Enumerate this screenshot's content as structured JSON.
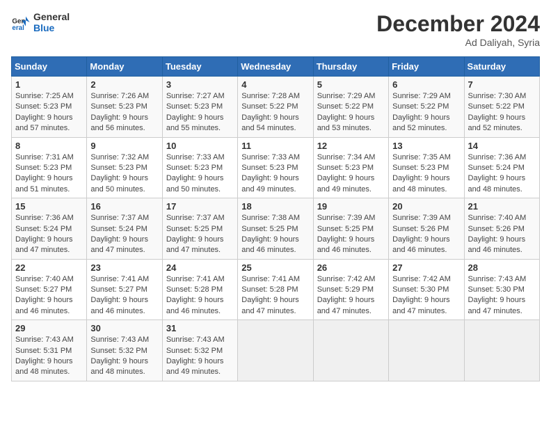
{
  "header": {
    "logo_line1": "General",
    "logo_line2": "Blue",
    "month_title": "December 2024",
    "location": "Ad Daliyah, Syria"
  },
  "days_of_week": [
    "Sunday",
    "Monday",
    "Tuesday",
    "Wednesday",
    "Thursday",
    "Friday",
    "Saturday"
  ],
  "weeks": [
    [
      {
        "day": "1",
        "sunrise": "7:25 AM",
        "sunset": "5:23 PM",
        "daylight_h": "9",
        "daylight_m": "57"
      },
      {
        "day": "2",
        "sunrise": "7:26 AM",
        "sunset": "5:23 PM",
        "daylight_h": "9",
        "daylight_m": "56"
      },
      {
        "day": "3",
        "sunrise": "7:27 AM",
        "sunset": "5:23 PM",
        "daylight_h": "9",
        "daylight_m": "55"
      },
      {
        "day": "4",
        "sunrise": "7:28 AM",
        "sunset": "5:22 PM",
        "daylight_h": "9",
        "daylight_m": "54"
      },
      {
        "day": "5",
        "sunrise": "7:29 AM",
        "sunset": "5:22 PM",
        "daylight_h": "9",
        "daylight_m": "53"
      },
      {
        "day": "6",
        "sunrise": "7:29 AM",
        "sunset": "5:22 PM",
        "daylight_h": "9",
        "daylight_m": "52"
      },
      {
        "day": "7",
        "sunrise": "7:30 AM",
        "sunset": "5:22 PM",
        "daylight_h": "9",
        "daylight_m": "52"
      }
    ],
    [
      {
        "day": "8",
        "sunrise": "7:31 AM",
        "sunset": "5:23 PM",
        "daylight_h": "9",
        "daylight_m": "51"
      },
      {
        "day": "9",
        "sunrise": "7:32 AM",
        "sunset": "5:23 PM",
        "daylight_h": "9",
        "daylight_m": "50"
      },
      {
        "day": "10",
        "sunrise": "7:33 AM",
        "sunset": "5:23 PM",
        "daylight_h": "9",
        "daylight_m": "50"
      },
      {
        "day": "11",
        "sunrise": "7:33 AM",
        "sunset": "5:23 PM",
        "daylight_h": "9",
        "daylight_m": "49"
      },
      {
        "day": "12",
        "sunrise": "7:34 AM",
        "sunset": "5:23 PM",
        "daylight_h": "9",
        "daylight_m": "49"
      },
      {
        "day": "13",
        "sunrise": "7:35 AM",
        "sunset": "5:23 PM",
        "daylight_h": "9",
        "daylight_m": "48"
      },
      {
        "day": "14",
        "sunrise": "7:36 AM",
        "sunset": "5:24 PM",
        "daylight_h": "9",
        "daylight_m": "48"
      }
    ],
    [
      {
        "day": "15",
        "sunrise": "7:36 AM",
        "sunset": "5:24 PM",
        "daylight_h": "9",
        "daylight_m": "47"
      },
      {
        "day": "16",
        "sunrise": "7:37 AM",
        "sunset": "5:24 PM",
        "daylight_h": "9",
        "daylight_m": "47"
      },
      {
        "day": "17",
        "sunrise": "7:37 AM",
        "sunset": "5:25 PM",
        "daylight_h": "9",
        "daylight_m": "47"
      },
      {
        "day": "18",
        "sunrise": "7:38 AM",
        "sunset": "5:25 PM",
        "daylight_h": "9",
        "daylight_m": "46"
      },
      {
        "day": "19",
        "sunrise": "7:39 AM",
        "sunset": "5:25 PM",
        "daylight_h": "9",
        "daylight_m": "46"
      },
      {
        "day": "20",
        "sunrise": "7:39 AM",
        "sunset": "5:26 PM",
        "daylight_h": "9",
        "daylight_m": "46"
      },
      {
        "day": "21",
        "sunrise": "7:40 AM",
        "sunset": "5:26 PM",
        "daylight_h": "9",
        "daylight_m": "46"
      }
    ],
    [
      {
        "day": "22",
        "sunrise": "7:40 AM",
        "sunset": "5:27 PM",
        "daylight_h": "9",
        "daylight_m": "46"
      },
      {
        "day": "23",
        "sunrise": "7:41 AM",
        "sunset": "5:27 PM",
        "daylight_h": "9",
        "daylight_m": "46"
      },
      {
        "day": "24",
        "sunrise": "7:41 AM",
        "sunset": "5:28 PM",
        "daylight_h": "9",
        "daylight_m": "46"
      },
      {
        "day": "25",
        "sunrise": "7:41 AM",
        "sunset": "5:28 PM",
        "daylight_h": "9",
        "daylight_m": "47"
      },
      {
        "day": "26",
        "sunrise": "7:42 AM",
        "sunset": "5:29 PM",
        "daylight_h": "9",
        "daylight_m": "47"
      },
      {
        "day": "27",
        "sunrise": "7:42 AM",
        "sunset": "5:30 PM",
        "daylight_h": "9",
        "daylight_m": "47"
      },
      {
        "day": "28",
        "sunrise": "7:43 AM",
        "sunset": "5:30 PM",
        "daylight_h": "9",
        "daylight_m": "47"
      }
    ],
    [
      {
        "day": "29",
        "sunrise": "7:43 AM",
        "sunset": "5:31 PM",
        "daylight_h": "9",
        "daylight_m": "48"
      },
      {
        "day": "30",
        "sunrise": "7:43 AM",
        "sunset": "5:32 PM",
        "daylight_h": "9",
        "daylight_m": "48"
      },
      {
        "day": "31",
        "sunrise": "7:43 AM",
        "sunset": "5:32 PM",
        "daylight_h": "9",
        "daylight_m": "49"
      },
      null,
      null,
      null,
      null
    ]
  ],
  "labels": {
    "sunrise": "Sunrise:",
    "sunset": "Sunset:",
    "daylight": "Daylight: ",
    "hours": " hours",
    "and": "and ",
    "minutes": " minutes."
  }
}
